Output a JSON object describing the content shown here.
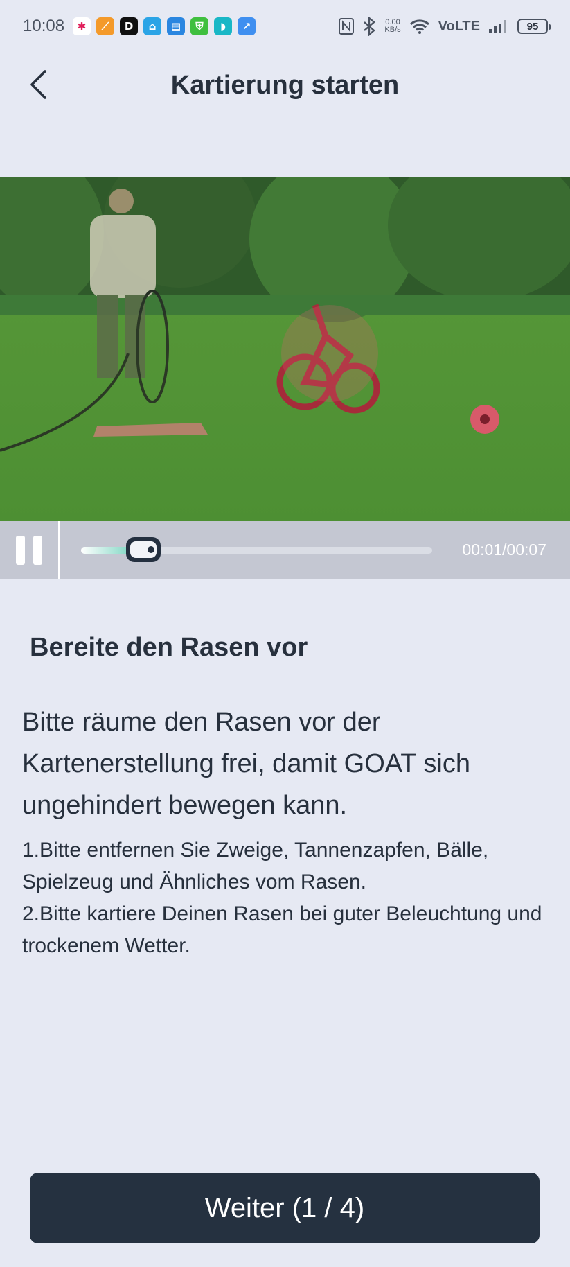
{
  "status_bar": {
    "time": "10:08",
    "app_icons": [
      {
        "name": "slack-icon",
        "color": "#ffffff",
        "glyph": "✱"
      },
      {
        "name": "orange-app-icon",
        "color": "#f49a2a",
        "glyph": "⟋"
      },
      {
        "name": "d-app-icon",
        "color": "#111111",
        "glyph": "D"
      },
      {
        "name": "blue-house-app-icon",
        "color": "#2ba4e6",
        "glyph": "⌂"
      },
      {
        "name": "blue-doc-app-icon",
        "color": "#2a86e0",
        "glyph": "▤"
      },
      {
        "name": "green-shield-app-icon",
        "color": "#3fbf3f",
        "glyph": "⛨"
      },
      {
        "name": "teal-app-icon",
        "color": "#19b7c6",
        "glyph": "◗"
      },
      {
        "name": "chart-app-icon",
        "color": "#3f8ff0",
        "glyph": "↗"
      }
    ],
    "speed_value": "0.00",
    "speed_unit": "KB/s",
    "network": "VoLTE",
    "battery": "95"
  },
  "header": {
    "title": "Kartierung starten"
  },
  "video": {
    "time": "00:01/00:07",
    "progress_fraction": 0.143
  },
  "content": {
    "section_title": "Bereite den Rasen vor",
    "lead": "Bitte räume den Rasen vor der Kartenerstellung frei, damit GOAT sich ungehindert bewegen kann.",
    "steps": [
      "1.Bitte entfernen Sie Zweige, Tannenzapfen, Bälle, Spielzeug und Ähnliches vom Rasen.",
      "2.Bitte kartiere Deinen Rasen bei guter Beleuchtung und trockenem Wetter."
    ]
  },
  "footer": {
    "next_label": "Weiter (1 / 4)"
  }
}
